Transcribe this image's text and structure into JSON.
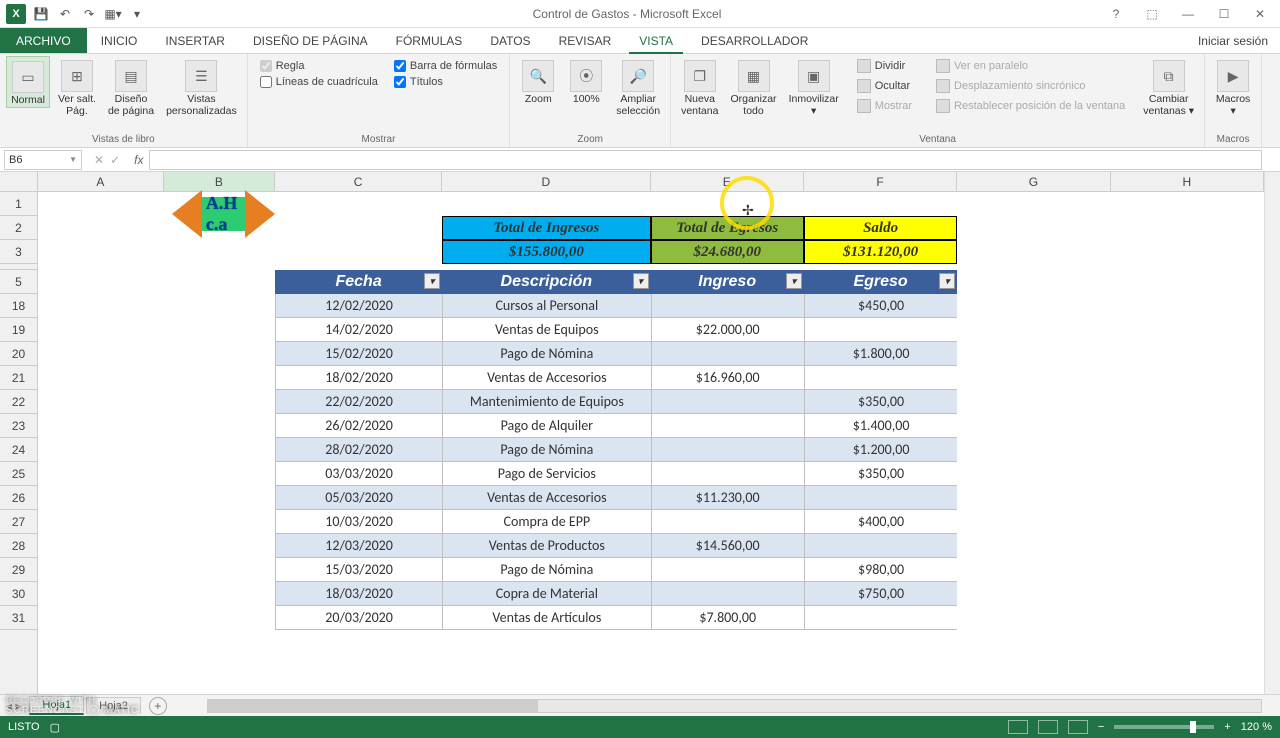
{
  "title": "Control de Gastos - Microsoft Excel",
  "help_icon": "?",
  "ribbon_opts_icon": "▾",
  "min_icon": "—",
  "max_icon": "☐",
  "close_icon": "✕",
  "tabs": {
    "file": "ARCHIVO",
    "items": [
      "INICIO",
      "INSERTAR",
      "DISEÑO DE PÁGINA",
      "FÓRMULAS",
      "DATOS",
      "REVISAR",
      "VISTA",
      "DESARROLLADOR"
    ],
    "active": "VISTA",
    "signin": "Iniciar sesión"
  },
  "ribbon": {
    "views": {
      "normal": "Normal",
      "pgbreak": "Ver salt.\nPág.",
      "layout": "Diseño\nde página",
      "custom": "Vistas\npersonalizadas",
      "group": "Vistas de libro"
    },
    "show": {
      "ruler": "Regla",
      "fbar": "Barra de fórmulas",
      "grid": "Líneas de cuadrícula",
      "titles": "Títulos",
      "group": "Mostrar"
    },
    "zoom": {
      "zoom": "Zoom",
      "z100": "100%",
      "zsel": "Ampliar\nselección",
      "group": "Zoom"
    },
    "window": {
      "neww": "Nueva\nventana",
      "arr": "Organizar\ntodo",
      "freeze": "Inmovilizar\n▾",
      "split": "Dividir",
      "hide": "Ocultar",
      "show": "Mostrar",
      "side": "Ver en paralelo",
      "sync": "Desplazamiento sincrónico",
      "reset": "Restablecer posición de la ventana",
      "switch": "Cambiar\nventanas ▾",
      "group": "Ventana"
    },
    "macros": {
      "macros": "Macros\n▾",
      "group": "Macros"
    }
  },
  "namebox": "B6",
  "fx": "fx",
  "cols": [
    "A",
    "B",
    "C",
    "D",
    "E",
    "F",
    "G",
    "H"
  ],
  "rows": [
    "1",
    "2",
    "3",
    "5",
    "18",
    "19",
    "20",
    "21",
    "22",
    "23",
    "24",
    "25",
    "26",
    "27",
    "28",
    "29",
    "30",
    "31"
  ],
  "logo": "A.H c.a",
  "summary": {
    "h1": "Total de Ingresos",
    "h2": "Total de Egresos",
    "h3": "Saldo",
    "v1": "$155.800,00",
    "v2": "$24.680,00",
    "v3": "$131.120,00"
  },
  "thead": {
    "c": "Fecha",
    "d": "Descripción",
    "e": "Ingreso",
    "f": "Egreso"
  },
  "tdata": [
    {
      "r": "18",
      "c": "12/02/2020",
      "d": "Cursos al Personal",
      "e": "",
      "f": "$450,00"
    },
    {
      "r": "19",
      "c": "14/02/2020",
      "d": "Ventas de Equipos",
      "e": "$22.000,00",
      "f": ""
    },
    {
      "r": "20",
      "c": "15/02/2020",
      "d": "Pago de Nómina",
      "e": "",
      "f": "$1.800,00"
    },
    {
      "r": "21",
      "c": "18/02/2020",
      "d": "Ventas de Accesorios",
      "e": "$16.960,00",
      "f": ""
    },
    {
      "r": "22",
      "c": "22/02/2020",
      "d": "Mantenimiento de Equipos",
      "e": "",
      "f": "$350,00"
    },
    {
      "r": "23",
      "c": "26/02/2020",
      "d": "Pago de Alquiler",
      "e": "",
      "f": "$1.400,00"
    },
    {
      "r": "24",
      "c": "28/02/2020",
      "d": "Pago de Nómina",
      "e": "",
      "f": "$1.200,00"
    },
    {
      "r": "25",
      "c": "03/03/2020",
      "d": "Pago de Servicios",
      "e": "",
      "f": "$350,00"
    },
    {
      "r": "26",
      "c": "05/03/2020",
      "d": "Ventas de Accesorios",
      "e": "$11.230,00",
      "f": ""
    },
    {
      "r": "27",
      "c": "10/03/2020",
      "d": "Compra de EPP",
      "e": "",
      "f": "$400,00"
    },
    {
      "r": "28",
      "c": "12/03/2020",
      "d": "Ventas de Productos",
      "e": "$14.560,00",
      "f": ""
    },
    {
      "r": "29",
      "c": "15/03/2020",
      "d": "Pago de Nómina",
      "e": "",
      "f": "$980,00"
    },
    {
      "r": "30",
      "c": "18/03/2020",
      "d": "Copra de Material",
      "e": "",
      "f": "$750,00"
    },
    {
      "r": "31",
      "c": "20/03/2020",
      "d": "Ventas de Artículos",
      "e": "$7.800,00",
      "f": ""
    }
  ],
  "sheets": {
    "s1": "Hoja1",
    "s2": "Hoja2"
  },
  "status": {
    "ready": "LISTO",
    "zoom": "120 %"
  },
  "watermark": {
    "l1": "RECORDED WITH",
    "l2": "SCREENCAST ◯ MATIC"
  }
}
